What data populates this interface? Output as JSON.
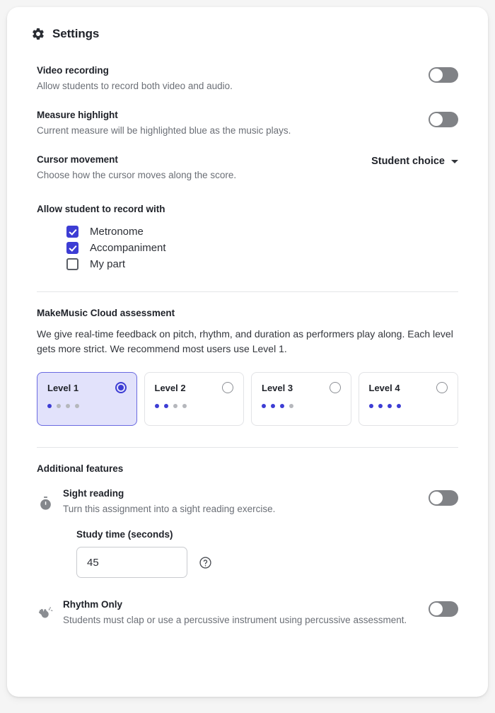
{
  "header": {
    "title": "Settings",
    "icon": "gear-icon"
  },
  "settings": [
    {
      "title": "Video recording",
      "desc": "Allow students to record both video and audio.",
      "control": "toggle",
      "value": "off"
    },
    {
      "title": "Measure highlight",
      "desc": "Current measure will be highlighted blue as the music plays.",
      "control": "toggle",
      "value": "off"
    },
    {
      "title": "Cursor movement",
      "desc": "Choose how the cursor moves along the score.",
      "control": "dropdown",
      "value": "Student choice"
    }
  ],
  "record_with": {
    "title": "Allow student to record with",
    "options": [
      {
        "label": "Metronome",
        "checked": true
      },
      {
        "label": "Accompaniment",
        "checked": true
      },
      {
        "label": "My part",
        "checked": false
      }
    ]
  },
  "assessment": {
    "title": "MakeMusic Cloud assessment",
    "desc": "We give real-time feedback on pitch, rhythm, and duration as performers play along. Each level gets more strict. We recommend most users use Level 1.",
    "levels": [
      {
        "label": "Level 1",
        "filled_dots": 1,
        "total_dots": 4,
        "selected": true
      },
      {
        "label": "Level 2",
        "filled_dots": 2,
        "total_dots": 4,
        "selected": false
      },
      {
        "label": "Level 3",
        "filled_dots": 3,
        "total_dots": 4,
        "selected": false
      },
      {
        "label": "Level 4",
        "filled_dots": 4,
        "total_dots": 4,
        "selected": false
      }
    ]
  },
  "additional_features": {
    "title": "Additional features",
    "sight_reading": {
      "icon": "stopwatch-icon",
      "title": "Sight reading",
      "desc": "Turn this assignment into a sight reading exercise.",
      "toggle": "off",
      "study_time_label": "Study time (seconds)",
      "study_time_value": "45",
      "study_time_placeholder": "45",
      "help_icon": "help-circle-icon"
    },
    "rhythm_only": {
      "icon": "clapping-hands-icon",
      "title": "Rhythm Only",
      "desc": "Students must clap or use a percussive instrument using percussive assessment.",
      "toggle": "off"
    }
  },
  "colors": {
    "accent": "#3d3dd4",
    "accent_soft": "#e2e2fb",
    "toggle_off": "#808286",
    "text": "#20232a",
    "muted": "#6b6f76"
  }
}
